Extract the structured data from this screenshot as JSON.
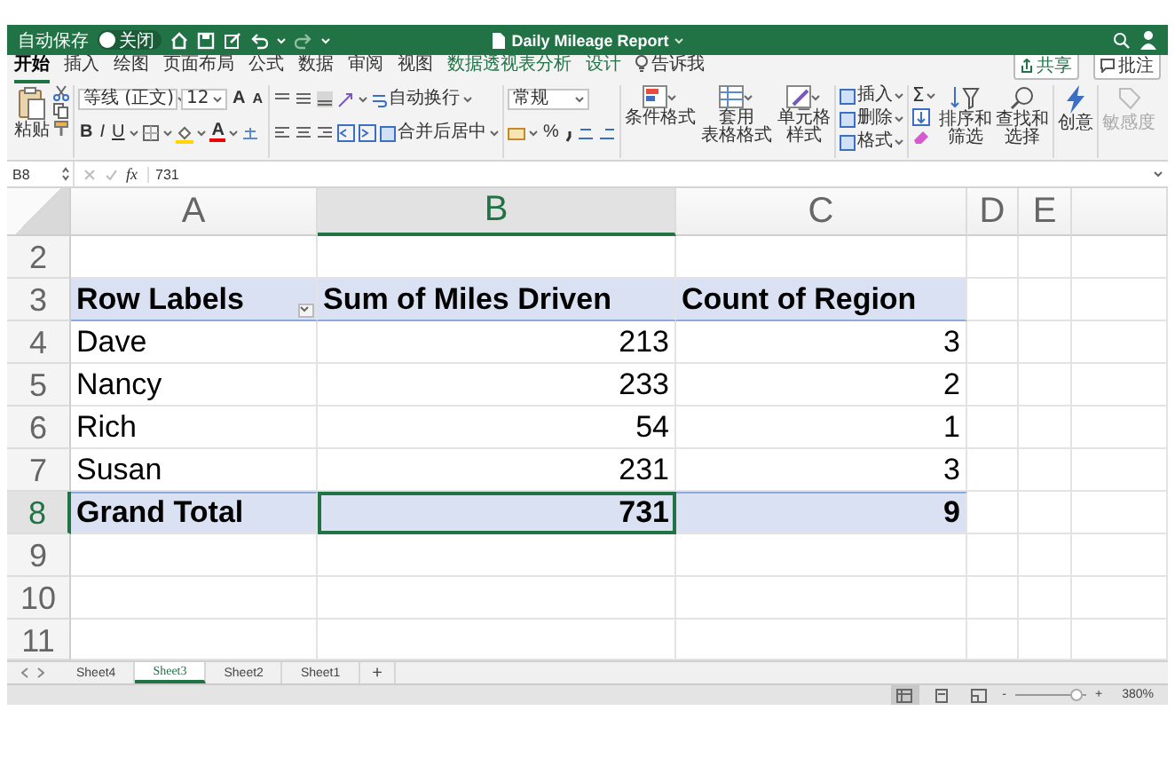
{
  "title_bar": {
    "autosave_label": "自动保存",
    "autosave_state": "关闭",
    "autosave_on": false,
    "title": "Daily Mileage Report"
  },
  "ribbon_tabs": [
    {
      "label": "开始",
      "selected": true,
      "kind": "normal"
    },
    {
      "label": "插入",
      "selected": false,
      "kind": "normal"
    },
    {
      "label": "绘图",
      "selected": false,
      "kind": "normal"
    },
    {
      "label": "页面布局",
      "selected": false,
      "kind": "normal"
    },
    {
      "label": "公式",
      "selected": false,
      "kind": "normal"
    },
    {
      "label": "数据",
      "selected": false,
      "kind": "normal"
    },
    {
      "label": "审阅",
      "selected": false,
      "kind": "normal"
    },
    {
      "label": "视图",
      "selected": false,
      "kind": "normal"
    },
    {
      "label": "数据透视表分析",
      "selected": false,
      "kind": "contextual"
    },
    {
      "label": "设计",
      "selected": false,
      "kind": "contextual"
    },
    {
      "label": "告诉我",
      "selected": false,
      "kind": "tell_me"
    }
  ],
  "share_button": "共享",
  "comments_button": "批注",
  "ribbon": {
    "paste": "粘贴",
    "font_name": "等线 (正文)",
    "font_size": "12",
    "grow_font": "A",
    "shrink_font": "A",
    "bold": "B",
    "italic": "I",
    "underline": "U",
    "font_color": "A",
    "wrap_text": "自动换行",
    "merge_center": "合并后居中",
    "number_format": "常规",
    "percent": "%",
    "styles": [
      {
        "lines": [
          "条件格式"
        ]
      },
      {
        "lines": [
          "套用",
          "表格格式"
        ]
      },
      {
        "lines": [
          "单元格",
          "样式"
        ]
      }
    ],
    "cells": [
      {
        "label": "插入"
      },
      {
        "label": "删除"
      },
      {
        "label": "格式"
      }
    ],
    "autosum": "Σ",
    "sort_filter": [
      "排序和",
      "筛选"
    ],
    "find_select": [
      "查找和",
      "选择"
    ],
    "ideas": "创意",
    "sensitivity": {
      "label": "敏感度",
      "disabled": true
    }
  },
  "formula_bar": {
    "name_box": "B8",
    "fx": "fx",
    "formula": "731"
  },
  "columns": [
    {
      "letter": "A",
      "selected": false
    },
    {
      "letter": "B",
      "selected": true
    },
    {
      "letter": "C",
      "selected": false
    },
    {
      "letter": "D",
      "selected": false
    },
    {
      "letter": "E",
      "selected": false
    }
  ],
  "rows": [
    {
      "number": "2",
      "kind": "blank",
      "selected": false
    },
    {
      "number": "3",
      "kind": "header",
      "selected": false,
      "cells": [
        {
          "text": "Row Labels",
          "kind": "filter_label",
          "selected": false
        },
        {
          "text": "Sum of Miles Driven",
          "kind": "label",
          "selected": false
        },
        {
          "text": "Count of Region",
          "kind": "label",
          "selected": false
        }
      ]
    },
    {
      "number": "4",
      "kind": "data",
      "selected": false,
      "cells": [
        {
          "text": "Dave",
          "kind": "label",
          "selected": false
        },
        {
          "text": "213",
          "kind": "number",
          "selected": false
        },
        {
          "text": "3",
          "kind": "number",
          "selected": false
        }
      ]
    },
    {
      "number": "5",
      "kind": "data",
      "selected": false,
      "cells": [
        {
          "text": "Nancy",
          "kind": "label",
          "selected": false
        },
        {
          "text": "233",
          "kind": "number",
          "selected": false
        },
        {
          "text": "2",
          "kind": "number",
          "selected": false
        }
      ]
    },
    {
      "number": "6",
      "kind": "data",
      "selected": false,
      "cells": [
        {
          "text": "Rich",
          "kind": "label",
          "selected": false
        },
        {
          "text": "54",
          "kind": "number",
          "selected": false
        },
        {
          "text": "1",
          "kind": "number",
          "selected": false
        }
      ]
    },
    {
      "number": "7",
      "kind": "data",
      "selected": false,
      "cells": [
        {
          "text": "Susan",
          "kind": "label",
          "selected": false
        },
        {
          "text": "231",
          "kind": "number",
          "selected": false
        },
        {
          "text": "3",
          "kind": "number",
          "selected": false
        }
      ]
    },
    {
      "number": "8",
      "kind": "total",
      "selected": true,
      "cells": [
        {
          "text": "Grand Total",
          "kind": "label",
          "selected": false
        },
        {
          "text": "731",
          "kind": "number",
          "selected": true
        },
        {
          "text": "9",
          "kind": "number",
          "selected": false
        }
      ]
    },
    {
      "number": "9",
      "kind": "blank",
      "selected": false
    },
    {
      "number": "10",
      "kind": "blank",
      "selected": false
    },
    {
      "number": "11",
      "kind": "blank",
      "selected": false
    }
  ],
  "sheet_tabs": [
    {
      "label": "Sheet4",
      "selected": false
    },
    {
      "label": "Sheet3",
      "selected": true
    },
    {
      "label": "Sheet2",
      "selected": false
    },
    {
      "label": "Sheet1",
      "selected": false
    }
  ],
  "add_sheet": "+",
  "status_bar": {
    "views": [
      {
        "selected": true
      },
      {
        "selected": false
      },
      {
        "selected": false
      }
    ],
    "zoom_minus": "-",
    "zoom_plus": "+",
    "level": 0.85,
    "zoom": "380%"
  }
}
